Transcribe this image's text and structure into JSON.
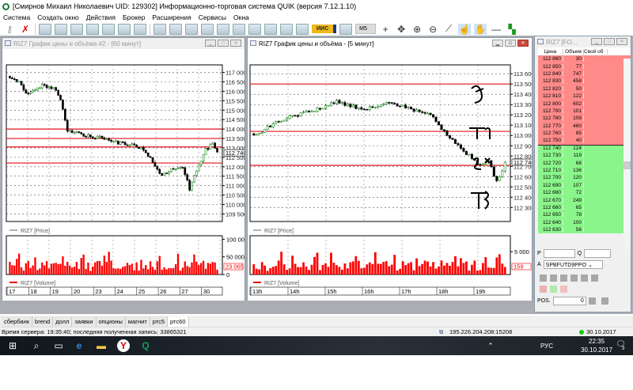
{
  "app": {
    "title": "[Смирнов Михаил Николаевич UID: 129302] Информационно-торговая система QUIK (версия 7.12.1.10)"
  },
  "menu": [
    "Система",
    "Создать окно",
    "Действия",
    "Брокер",
    "Расширения",
    "Сервисы",
    "Окна"
  ],
  "toolbar": {
    "iis_label": "ИИС",
    "interval": "M5"
  },
  "chart_left": {
    "title": "RIZ7 График цены и объёма #2 - [60 минут]",
    "price_ticks": [
      "117 000",
      "116 500",
      "116 000",
      "115 500",
      "115 000",
      "114 500",
      "114 000",
      "113 500",
      "113 000",
      "112 500",
      "112 000",
      "111 500",
      "111 000",
      "110 500",
      "110 000",
      "109 500"
    ],
    "price_range": [
      109350,
      117150
    ],
    "current_price": "112 740",
    "levels": [
      114000,
      113500,
      113050,
      112200
    ],
    "keypoints": [
      [
        0,
        116700
      ],
      [
        4,
        116500
      ],
      [
        8,
        115800
      ],
      [
        14,
        116300
      ],
      [
        20,
        116100
      ],
      [
        22,
        115600
      ],
      [
        25,
        113900
      ],
      [
        32,
        113700
      ],
      [
        40,
        113500
      ],
      [
        45,
        113300
      ],
      [
        52,
        113200
      ],
      [
        58,
        112950
      ],
      [
        63,
        112100
      ],
      [
        66,
        111500
      ],
      [
        70,
        111900
      ],
      [
        75,
        112000
      ],
      [
        78,
        110800
      ],
      [
        81,
        111800
      ],
      [
        85,
        112900
      ],
      [
        88,
        113200
      ],
      [
        90,
        112740
      ]
    ],
    "price_legend": "RIZ7 [Price]",
    "volume_ticks": [
      "100 000",
      "50 000",
      "0"
    ],
    "volume_max": 110000,
    "current_volume": "23 065",
    "volume_legend": "RIZ7 [Volume]",
    "dates": [
      "17",
      "18",
      "19",
      "20",
      "23",
      "24",
      "25",
      "26",
      "27",
      "30"
    ]
  },
  "chart_right": {
    "title": "RIZ7 График цены и объёма - [5 минут]",
    "price_ticks": [
      "113 600",
      "113 500",
      "113 400",
      "113 300",
      "113 200",
      "113 100",
      "113 000",
      "112 900",
      "112 800",
      "112 700",
      "112 600",
      "112 500",
      "112 400",
      "112 300"
    ],
    "price_range": [
      112210,
      113640
    ],
    "current_price": "112 740",
    "levels": [
      113500,
      113040,
      112710
    ],
    "keypoints": [
      [
        0,
        113000
      ],
      [
        10,
        113150
      ],
      [
        22,
        113250
      ],
      [
        30,
        113330
      ],
      [
        40,
        113250
      ],
      [
        48,
        113330
      ],
      [
        58,
        113250
      ],
      [
        64,
        113200
      ],
      [
        70,
        113000
      ],
      [
        74,
        112900
      ],
      [
        78,
        112800
      ],
      [
        82,
        112700
      ],
      [
        85,
        112750
      ],
      [
        88,
        112550
      ],
      [
        90,
        112650
      ],
      [
        91,
        112740
      ]
    ],
    "price_legend": "RIZ7 [Price]",
    "volume_ticks": [
      "5 000"
    ],
    "volume_max": 8500,
    "current_volume": "159",
    "volume_legend": "RIZ7 [Volume]",
    "hours": [
      "13h",
      "14h",
      "15h",
      "16h",
      "17h",
      "18h",
      "19h"
    ]
  },
  "orderbook": {
    "title": "RIZ7 [FO...",
    "headers": [
      "Цена",
      "Объем",
      "Свой об"
    ],
    "asks": [
      [
        "112 860",
        "30"
      ],
      [
        "112 850",
        "77"
      ],
      [
        "112 840",
        "747"
      ],
      [
        "112 830",
        "458"
      ],
      [
        "112 820",
        "50"
      ],
      [
        "112 810",
        "122"
      ],
      [
        "112 800",
        "602"
      ],
      [
        "112 790",
        "101"
      ],
      [
        "112 780",
        "109"
      ],
      [
        "112 770",
        "460"
      ],
      [
        "112 760",
        "85"
      ],
      [
        "112 750",
        "40"
      ]
    ],
    "bids": [
      [
        "112 740",
        "124"
      ],
      [
        "112 730",
        "119"
      ],
      [
        "112 720",
        "68"
      ],
      [
        "112 710",
        "136"
      ],
      [
        "112 700",
        "120"
      ],
      [
        "112 690",
        "107"
      ],
      [
        "112 680",
        "72"
      ],
      [
        "112 670",
        "249"
      ],
      [
        "112 660",
        "65"
      ],
      [
        "112 650",
        "78"
      ],
      [
        "112 640",
        "100"
      ],
      [
        "112 630",
        "56"
      ]
    ],
    "p_label": "P",
    "q_label": "Q",
    "a_label": "A",
    "account": "SPBFUTD9PPO",
    "pos_label": "POS.",
    "pos_value": "0"
  },
  "tabs": [
    "сбербанк",
    "brend",
    "долл",
    "заявки",
    "опционы",
    "магнит",
    "ртс5",
    "ртс60"
  ],
  "status": {
    "server": "Время сервера: 19:35:40; последняя полученная запись: 33865321",
    "connection": "195.226.204.208:15208",
    "date": "30.10.2017"
  },
  "taskbar": {
    "lang": "РУС",
    "time": "22:35",
    "date": "30.10.2017",
    "notifications": "3"
  },
  "colors": {
    "level": "#e0141e",
    "up": "#ffffff",
    "down": "#000000",
    "volume": "#ff0000",
    "ask": "#ff8a8a",
    "bid": "#8af58a"
  }
}
